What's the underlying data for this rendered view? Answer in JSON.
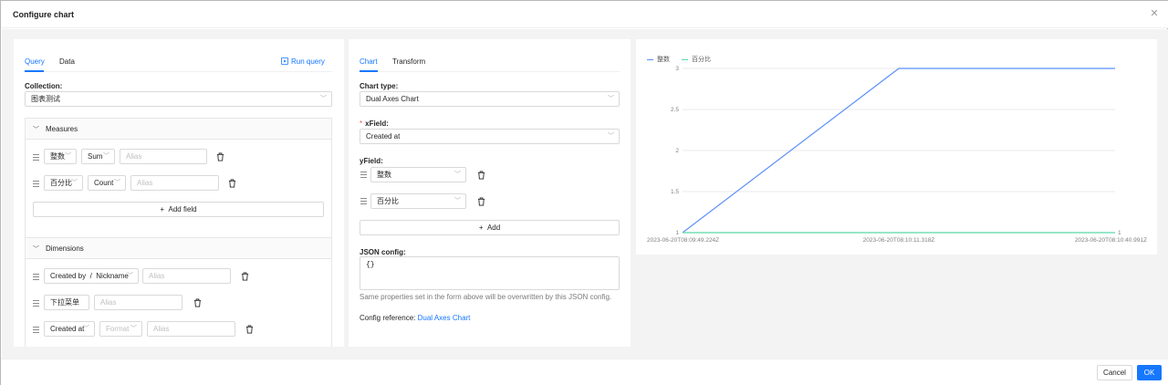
{
  "dialog": {
    "title": "Configure chart",
    "close_icon": "close-icon",
    "cancel_label": "Cancel",
    "ok_label": "OK",
    "accent_color": "#1677ff"
  },
  "query_panel": {
    "tabs": [
      {
        "label": "Query",
        "active": true
      },
      {
        "label": "Data",
        "active": false
      }
    ],
    "run_query_label": "Run query",
    "run_query_icon": "play-square-icon",
    "collection_label": "Collection",
    "collection_value": "图表测试",
    "measures": {
      "title": "Measures",
      "items": [
        {
          "field": "整数",
          "aggregation": "Sum",
          "alias_placeholder": "Alias"
        },
        {
          "field": "百分比",
          "aggregation": "Count",
          "alias_placeholder": "Alias"
        }
      ],
      "add_field_label": "Add field"
    },
    "dimensions": {
      "title": "Dimensions",
      "items": [
        {
          "field": "Created by",
          "separator": "/",
          "subfield": "Nickname",
          "alias_placeholder": "Alias"
        },
        {
          "field": "下拉菜单",
          "alias_placeholder": "Alias"
        },
        {
          "field": "Created at",
          "format_placeholder": "Format",
          "alias_placeholder": "Alias"
        }
      ]
    }
  },
  "chart_panel": {
    "tabs": [
      {
        "label": "Chart",
        "active": true
      },
      {
        "label": "Transform",
        "active": false
      }
    ],
    "chart_type_label": "Chart type",
    "chart_type_value": "Dual Axes Chart",
    "xfield_label": "xField",
    "xfield_value": "Created at",
    "yfield_label": "yField",
    "yfield_items": [
      "整数",
      "百分比"
    ],
    "add_label": "Add",
    "json_config_label": "JSON config",
    "json_config_value": "{}",
    "help_text": "Same properties set in the form above will be overwritten by this JSON config.",
    "config_reference_label": "Config reference: ",
    "config_reference_link": "Dual Axes Chart"
  },
  "chart_data": {
    "type": "line",
    "x": [
      "2023-06-20T08:09:49.224Z",
      "2023-06-20T08:10:11.318Z",
      "2023-06-20T08:10:40.991Z"
    ],
    "series": [
      {
        "name": "整数",
        "values": [
          1,
          3,
          3
        ],
        "color": "#5b8ff9",
        "axis": "left"
      },
      {
        "name": "百分比",
        "values": [
          1,
          1,
          1
        ],
        "color": "#5ad8a6",
        "axis": "right"
      }
    ],
    "y_left_ticks": [
      "1",
      "1.5",
      "2",
      "2.5",
      "3"
    ],
    "y_right_ticks": [
      "1"
    ],
    "x_tick_labels": [
      "2023-06-20T08:09:49.224Z",
      "2023-06-20T08:10:11.318Z",
      "2023-06-20T08:10:40.991Z"
    ],
    "ylim_left": [
      1,
      3
    ],
    "ylim_right": [
      1,
      1
    ],
    "legend_position": "top-left",
    "grid": true,
    "title": "",
    "xlabel": "",
    "ylabel": ""
  }
}
